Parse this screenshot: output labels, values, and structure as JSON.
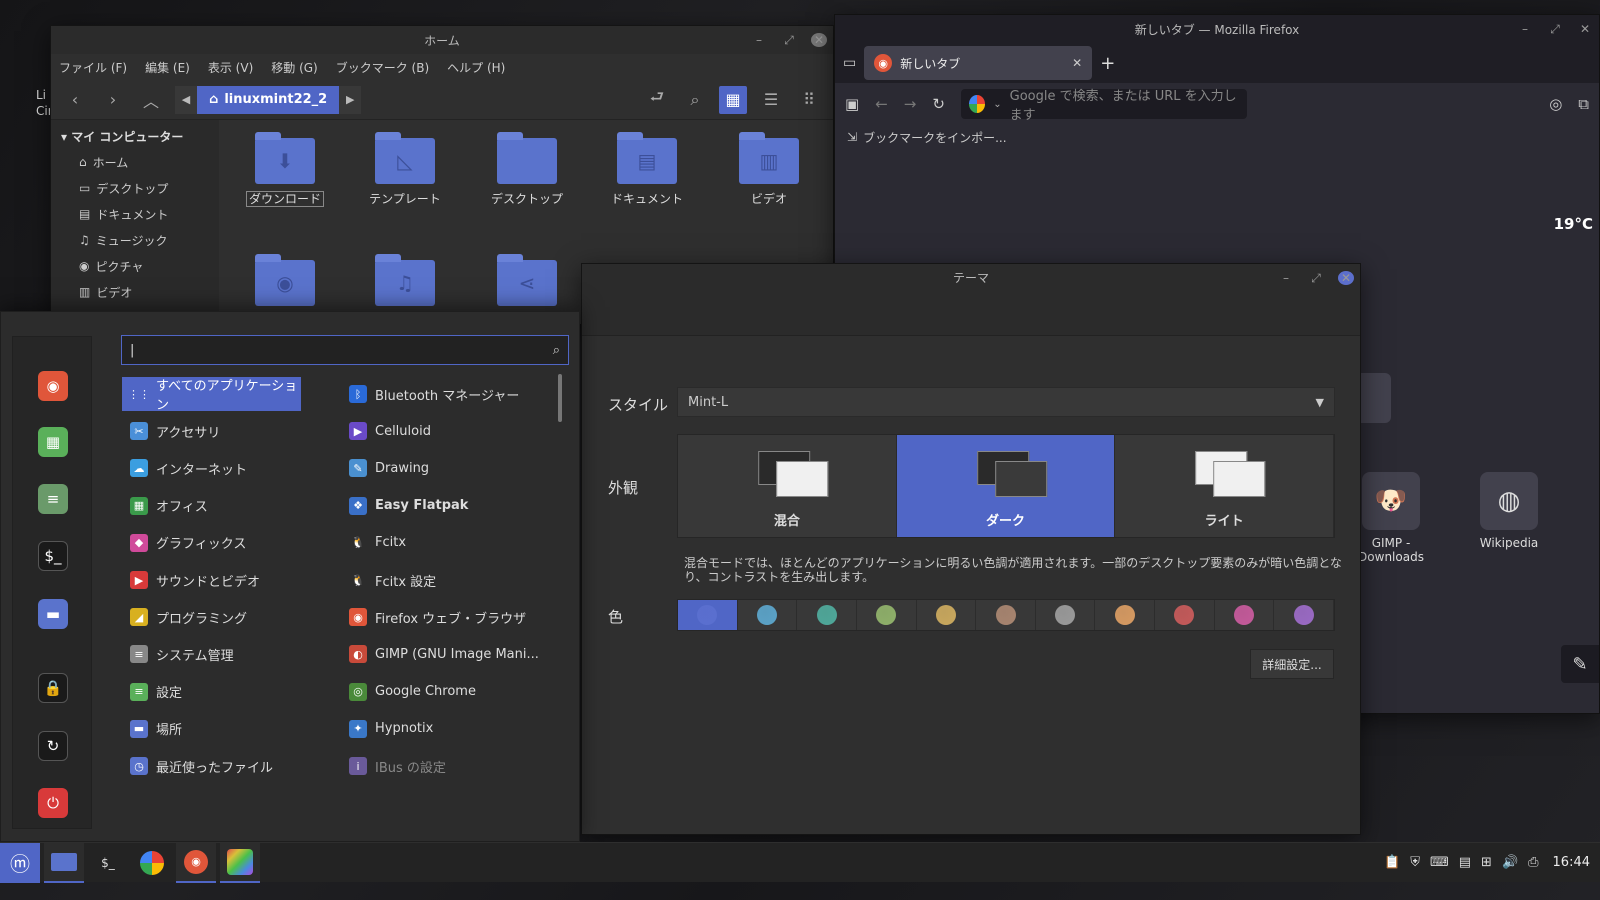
{
  "desktop": {
    "label_line1": "Li",
    "label_line2": "Cir"
  },
  "nemo": {
    "title": "ホーム",
    "menu": [
      "ファイル (F)",
      "編集 (E)",
      "表示 (V)",
      "移動 (G)",
      "ブックマーク (B)",
      "ヘルプ (H)"
    ],
    "path": "linuxmint22_2",
    "sidebar_header": "マイ コンピューター",
    "sidebar": [
      {
        "label": "ホーム",
        "icon": "home-icon"
      },
      {
        "label": "デスクトップ",
        "icon": "desktop-icon"
      },
      {
        "label": "ドキュメント",
        "icon": "document-icon"
      },
      {
        "label": "ミュージック",
        "icon": "music-icon"
      },
      {
        "label": "ピクチャ",
        "icon": "camera-icon"
      },
      {
        "label": "ビデオ",
        "icon": "video-icon"
      }
    ],
    "files": [
      {
        "label": "ダウンロード",
        "glyph": "⬇"
      },
      {
        "label": "テンプレート",
        "glyph": "◺"
      },
      {
        "label": "デスクトップ",
        "glyph": ""
      },
      {
        "label": "ドキュメント",
        "glyph": "▤"
      },
      {
        "label": "ビデオ",
        "glyph": "▥"
      },
      {
        "label": "",
        "glyph": "◉"
      },
      {
        "label": "",
        "glyph": "♫"
      },
      {
        "label": "",
        "glyph": "⋖"
      }
    ]
  },
  "firefox": {
    "title": "新しいタブ — Mozilla Firefox",
    "tab_label": "新しいタブ",
    "url_placeholder": "Google で検索、または URL を入力します",
    "bookmark_import": "ブックマークをインポー...",
    "weather": "19°C",
    "shortcuts": [
      {
        "label": "GIMP - Downloads",
        "icon": "gimp-icon"
      },
      {
        "label": "Wikipedia",
        "icon": "wikipedia-icon"
      }
    ]
  },
  "theme": {
    "title": "テーマ",
    "style_label": "スタイル",
    "style_value": "Mint-L",
    "appearance_label": "外観",
    "appearance_options": [
      "混合",
      "ダーク",
      "ライト"
    ],
    "appearance_selected": "ダーク",
    "description": "混合モードでは、ほとんどのアプリケーションに明るい色調が適用されます。一部のデスクトップ要素のみが暗い色調となり、コントラストを生み出します。",
    "color_label": "色",
    "colors": [
      "#5a6fcf",
      "#5ba3c8",
      "#4fa89a",
      "#8fb06a",
      "#c9a85e",
      "#a88570",
      "#9a9a9a",
      "#d69a62",
      "#c45a5a",
      "#c45a9a",
      "#9a6ac4"
    ],
    "advanced_button": "詳細設定..."
  },
  "menu": {
    "search_value": "|",
    "categories": [
      {
        "label": "すべてのアプリケーション",
        "color": "#5066c6",
        "glyph": "⋮⋮"
      },
      {
        "label": "アクセサリ",
        "color": "#4a8fd8",
        "glyph": "✂"
      },
      {
        "label": "インターネット",
        "color": "#3b9ee0",
        "glyph": "☁"
      },
      {
        "label": "オフィス",
        "color": "#3a9a4a",
        "glyph": "▦"
      },
      {
        "label": "グラフィックス",
        "color": "#d04a9a",
        "glyph": "◆"
      },
      {
        "label": "サウンドとビデオ",
        "color": "#d83a3a",
        "glyph": "▶"
      },
      {
        "label": "プログラミング",
        "color": "#d8b020",
        "glyph": "◢"
      },
      {
        "label": "システム管理",
        "color": "#888888",
        "glyph": "≡"
      },
      {
        "label": "設定",
        "color": "#5ab05a",
        "glyph": "≡"
      },
      {
        "label": "場所",
        "color": "#5a73cc",
        "glyph": "▬"
      },
      {
        "label": "最近使ったファイル",
        "color": "#5a73cc",
        "glyph": "◷"
      }
    ],
    "apps": [
      {
        "label": "Bluetooth マネージャー",
        "color": "#2a6ad8",
        "glyph": "ᛒ"
      },
      {
        "label": "Celluloid",
        "color": "#6a4ac8",
        "glyph": "▶"
      },
      {
        "label": "Drawing",
        "color": "#4a90d0",
        "glyph": "✎"
      },
      {
        "label": "Easy Flatpak",
        "color": "#3a70c8",
        "glyph": "❖"
      },
      {
        "label": "Fcitx",
        "color": "#2c2c2c",
        "glyph": "🐧"
      },
      {
        "label": "Fcitx 設定",
        "color": "#2c2c2c",
        "glyph": "🐧"
      },
      {
        "label": "Firefox ウェブ・ブラウザ",
        "color": "#e0563a",
        "glyph": "◉"
      },
      {
        "label": "GIMP (GNU Image Mani...",
        "color": "#c84a3a",
        "glyph": "◐"
      },
      {
        "label": "Google Chrome",
        "color": "#4a8a3a",
        "glyph": "◎"
      },
      {
        "label": "Hypnotix",
        "color": "#3a78c8",
        "glyph": "✦"
      },
      {
        "label": "IBus の設定",
        "color": "#6a5a9a",
        "glyph": "i"
      }
    ],
    "favorites": [
      {
        "name": "firefox-fav",
        "color": "#e0563a",
        "glyph": "◉"
      },
      {
        "name": "software-manager-fav",
        "color": "#5ab05a",
        "glyph": "▦"
      },
      {
        "name": "settings-fav",
        "color": "#6a9a6a",
        "glyph": "≡"
      },
      {
        "name": "terminal-fav",
        "color": "#1a1a1a",
        "glyph": "$_"
      },
      {
        "name": "files-fav",
        "color": "#5a73cc",
        "glyph": "▬"
      },
      {
        "name": "lock-fav",
        "color": "#1a1a1a",
        "glyph": "🔒"
      },
      {
        "name": "logout-fav",
        "color": "#1a1a1a",
        "glyph": "↻"
      },
      {
        "name": "power-fav",
        "color": "#d83a3a",
        "glyph": "⏻"
      }
    ]
  },
  "taskbar": {
    "clock": "16:44"
  }
}
